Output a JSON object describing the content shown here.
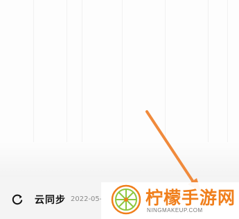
{
  "sync_bar": {
    "icon": "refresh-icon",
    "label": "云同步",
    "date": "2022-05-2"
  },
  "watermark": {
    "title": "柠檬手游网",
    "url": "NINGMAKEUP.COM",
    "brand_color": "#f07f1c",
    "logo_green": "#8dc63f"
  },
  "annotation": {
    "arrow_color": "#f08a3c"
  }
}
